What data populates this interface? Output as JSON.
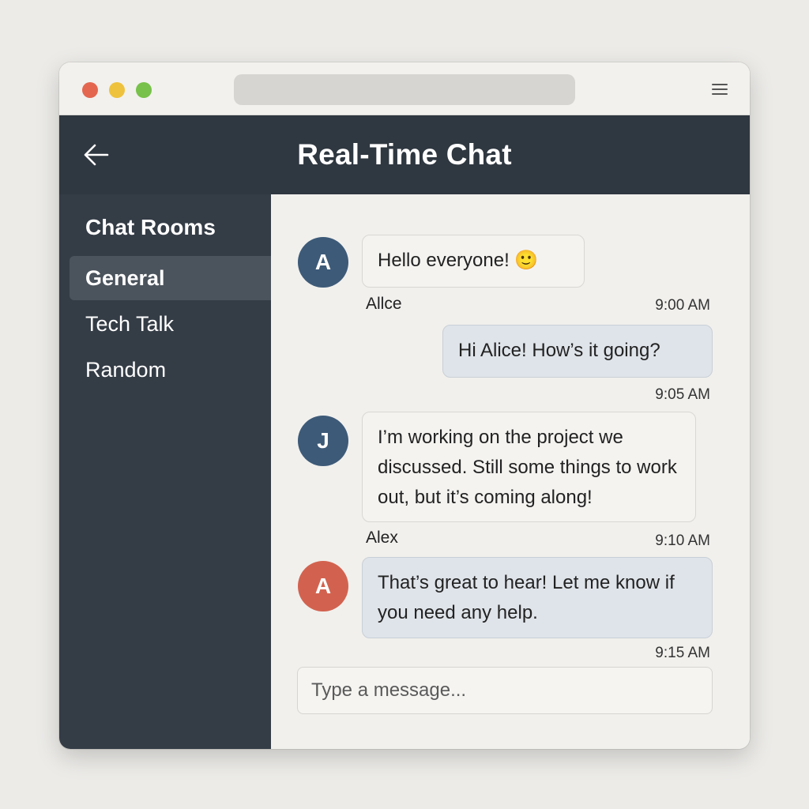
{
  "app": {
    "title": "Real-Time Chat"
  },
  "sidebar": {
    "heading": "Chat Rooms",
    "rooms": [
      {
        "label": "General",
        "active": true
      },
      {
        "label": "Tech Talk",
        "active": false
      },
      {
        "label": "Random",
        "active": false
      }
    ]
  },
  "messages": [
    {
      "avatar": "A",
      "avatar_color": "#3d5a78",
      "text": "Hello everyone! 🙂",
      "sender": "Allce",
      "time": "9:00 AM",
      "direction": "in"
    },
    {
      "text": "Hi Alice! How’s it going?",
      "time": "9:05 AM",
      "direction": "out"
    },
    {
      "avatar": "J",
      "avatar_color": "#3d5a78",
      "text": "I’m working on the project we discussed. Still some things to work out, but it’s coming along!",
      "sender": "Alex",
      "time": "9:10 AM",
      "direction": "in"
    },
    {
      "avatar": "A",
      "avatar_color": "#d2624f",
      "text": "That’s great to hear! Let me know if you need any help.",
      "time": "9:15 AM",
      "direction": "out"
    }
  ],
  "composer": {
    "placeholder": "Type a message..."
  },
  "icons": {
    "back": "arrow-left-icon",
    "menu": "hamburger-menu-icon"
  },
  "colors": {
    "header_bg": "#2f3740",
    "sidebar_bg": "#343c46",
    "active_room_bg": "#4b535c",
    "outgoing_bubble": "#dfe4ea"
  }
}
